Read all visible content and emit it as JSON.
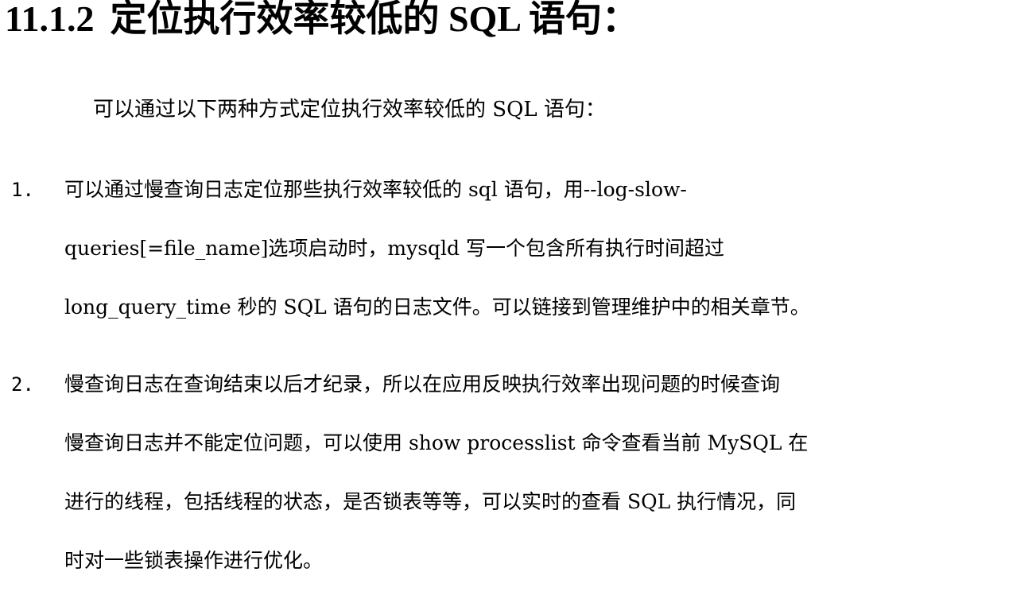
{
  "heading": {
    "number": "11.1.2",
    "title": "定位执行效率较低的 SQL 语句："
  },
  "intro": "可以通过以下两种方式定位执行效率较低的 SQL 语句：",
  "items": [
    {
      "marker": "1.",
      "lines": [
        "可以通过慢查询日志定位那些执行效率较低的 sql 语句，用--log-slow-",
        "queries[=file_name]选项启动时，mysqld 写一个包含所有执行时间超过",
        "long_query_time 秒的 SQL 语句的日志文件。可以链接到管理维护中的相关章节。"
      ]
    },
    {
      "marker": "2.",
      "lines": [
        "慢查询日志在查询结束以后才纪录，所以在应用反映执行效率出现问题的时候查询",
        "慢查询日志并不能定位问题，可以使用 show processlist 命令查看当前 MySQL 在",
        "进行的线程，包括线程的状态，是否锁表等等，可以实时的查看 SQL 执行情况，同",
        "时对一些锁表操作进行优化。"
      ]
    }
  ]
}
